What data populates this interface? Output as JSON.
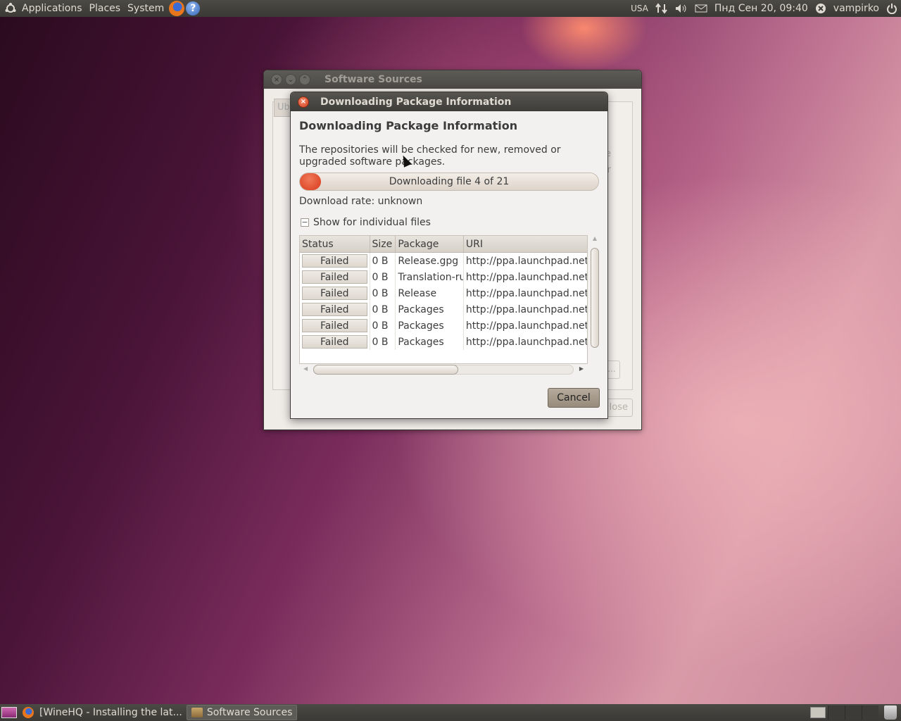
{
  "top_panel": {
    "menus": [
      "Applications",
      "Places",
      "System"
    ],
    "keyboard_layout": "USA",
    "datetime": "Пнд Сен 20, 09:40",
    "user": "vampirko"
  },
  "bottom_panel": {
    "tasks": [
      {
        "label": "[WineHQ - Installing the lat..."
      },
      {
        "label": "Software Sources"
      }
    ]
  },
  "bg_window": {
    "title": "Software Sources",
    "tab_partial": "Ub",
    "right_label_1": "ode",
    "right_label_2": "air",
    "close_partial": "lose",
    "ellipsis": "..."
  },
  "dialog": {
    "title": "Downloading Package Information",
    "heading": "Downloading Package Information",
    "description": "The repositories will be checked for new, removed or upgraded software packages.",
    "progress_text": "Downloading file 4 of 21",
    "progress_fraction": 0.07,
    "rate": "Download rate: unknown",
    "expander_label": "Show for individual files",
    "expander_symbol": "−",
    "columns": [
      "Status",
      "Size",
      "Package",
      "URI"
    ],
    "rows": [
      {
        "status": "Failed",
        "size": "0 B",
        "package": "Release.gpg",
        "uri": "http://ppa.launchpad.net lu"
      },
      {
        "status": "Failed",
        "size": "0 B",
        "package": "Translation-ru",
        "uri": "http://ppa.launchpad.net/u"
      },
      {
        "status": "Failed",
        "size": "0 B",
        "package": "Release",
        "uri": "http://ppa.launchpad.net lu"
      },
      {
        "status": "Failed",
        "size": "0 B",
        "package": "Packages",
        "uri": "http://ppa.launchpad.net lu"
      },
      {
        "status": "Failed",
        "size": "0 B",
        "package": "Packages",
        "uri": "http://ppa.launchpad.net lu"
      },
      {
        "status": "Failed",
        "size": "0 B",
        "package": "Packages",
        "uri": "http://ppa.launchpad.net lu"
      }
    ],
    "cancel_label": "Cancel"
  },
  "colors": {
    "accent": "#d8391b",
    "panel": "#3c3b37"
  },
  "icons": [
    "ubuntu-logo-icon",
    "firefox-icon",
    "help-icon",
    "network-icon",
    "volume-icon",
    "mail-icon",
    "user-status-icon",
    "power-icon",
    "close-icon",
    "trash-icon"
  ]
}
